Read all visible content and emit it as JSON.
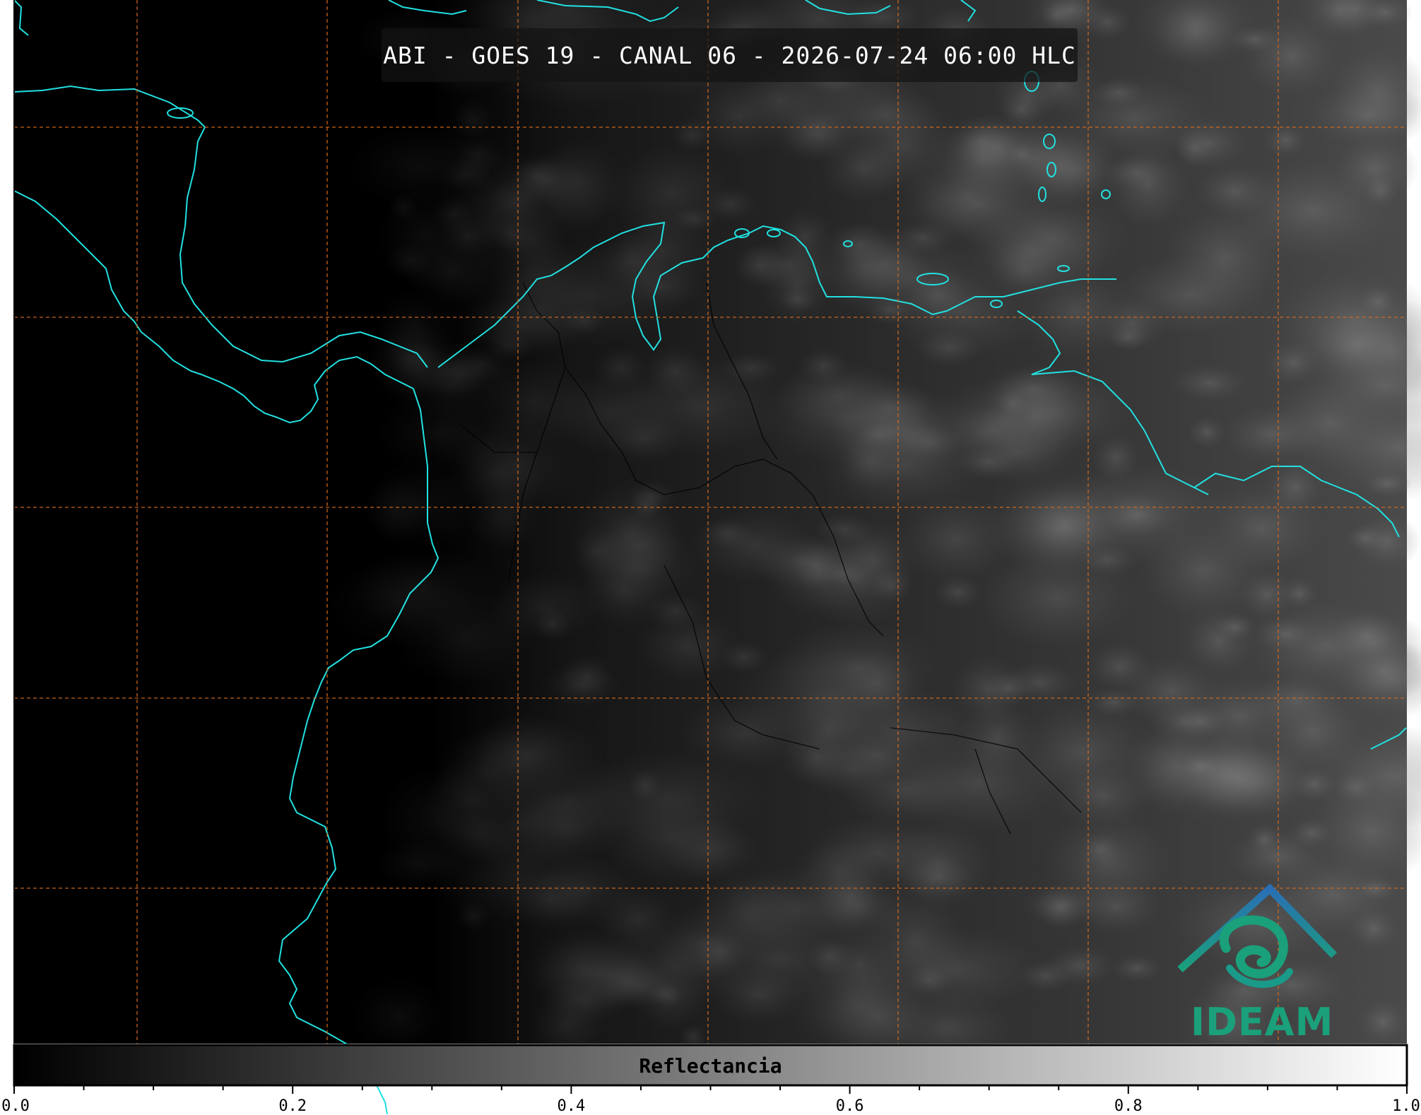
{
  "title": "ABI - GOES 19 - CANAL 06 - 2026-07-24 06:00 HLC",
  "colorbar": {
    "label": "Reflectancia",
    "ticks": [
      "0.0",
      "0.2",
      "0.4",
      "0.6",
      "0.8",
      "1.0"
    ],
    "range": [
      0.0,
      1.0
    ],
    "colormap": [
      "#000000",
      "#ffffff"
    ]
  },
  "logo": {
    "text": "IDEAM"
  },
  "colors": {
    "coastline": "#22e0e0",
    "gridline": "#d2691e",
    "borders": "#000000",
    "logo_blue": "#2a6fb5",
    "logo_green": "#1aa07a"
  },
  "map": {
    "product": "ABI",
    "satellite": "GOES 19",
    "channel": "CANAL 06",
    "datetime": "2026-07-24 06:00 HLC",
    "grid": "dashed"
  }
}
